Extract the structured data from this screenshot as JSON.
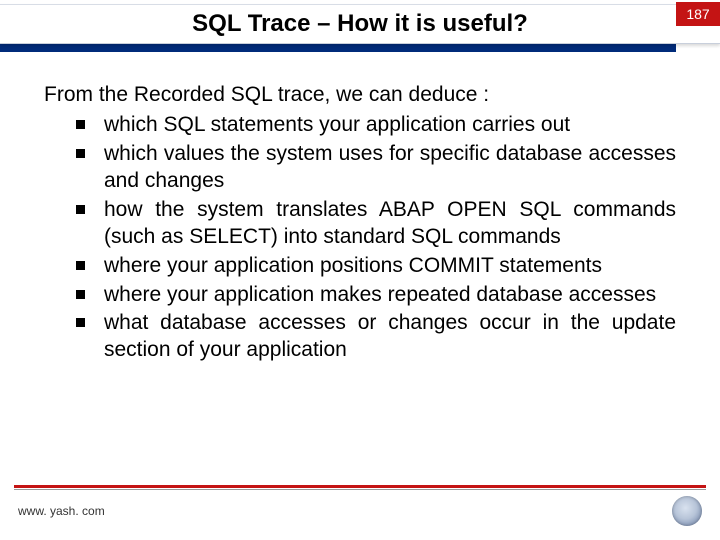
{
  "header": {
    "title": "SQL Trace – How it is useful?",
    "page_number": "187"
  },
  "body": {
    "intro": "From the Recorded SQL trace, we can deduce :",
    "bullets": [
      "which SQL statements your application carries out",
      "which values the system uses for specific database accesses and changes",
      "how the system translates ABAP OPEN SQL commands (such as SELECT) into standard SQL commands",
      "where your application positions COMMIT statements",
      "where your application makes repeated database accesses",
      "what database accesses or changes occur in the update section of your application"
    ]
  },
  "footer": {
    "url": "www. yash. com"
  }
}
